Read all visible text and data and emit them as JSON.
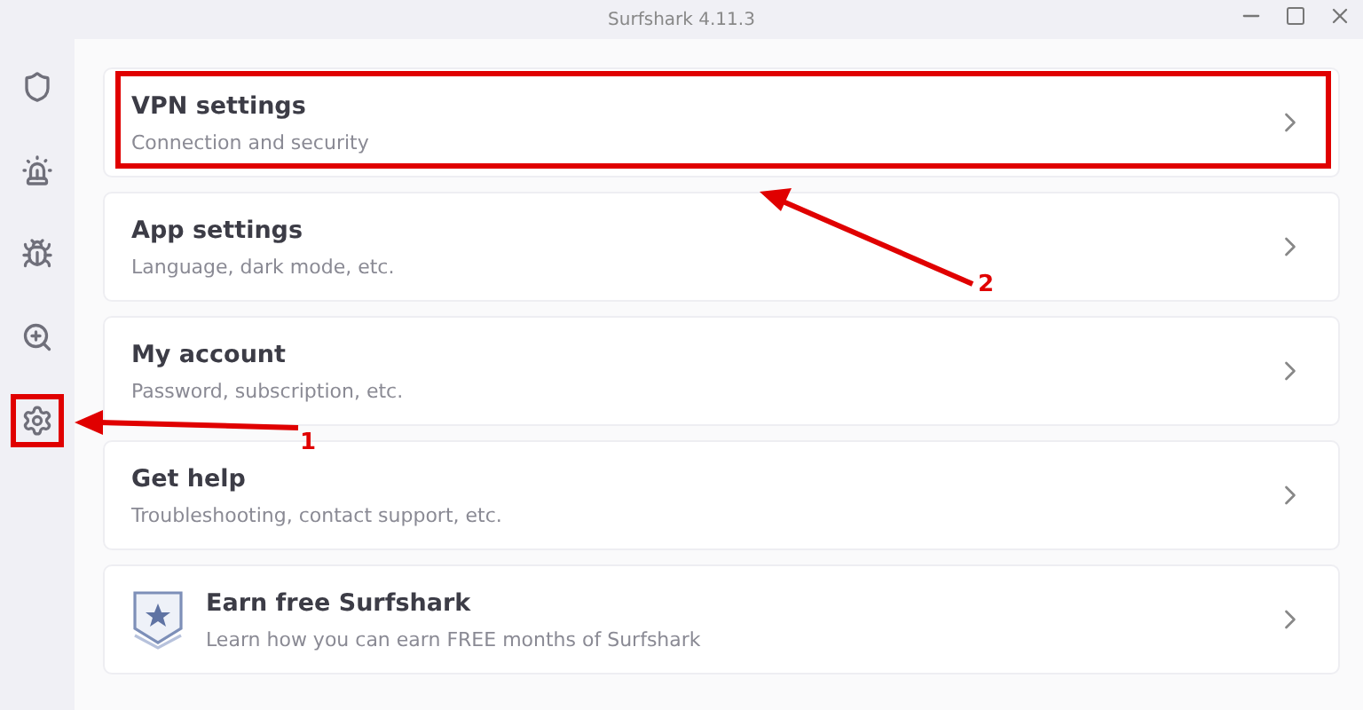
{
  "window": {
    "title": "Surfshark 4.11.3"
  },
  "sidebar": {
    "items": [
      {
        "kind": "shield",
        "highlighted": false
      },
      {
        "kind": "alert",
        "highlighted": false
      },
      {
        "kind": "bug",
        "highlighted": false
      },
      {
        "kind": "search",
        "highlighted": false
      },
      {
        "kind": "settings",
        "highlighted": true,
        "callout": "1"
      }
    ]
  },
  "cards": [
    {
      "kind": "plain",
      "title": "VPN settings",
      "subtitle": "Connection and security",
      "highlighted": true,
      "callout": "2"
    },
    {
      "kind": "plain",
      "title": "App settings",
      "subtitle": "Language, dark mode, etc.",
      "highlighted": false
    },
    {
      "kind": "plain",
      "title": "My account",
      "subtitle": "Password, subscription, etc.",
      "highlighted": false
    },
    {
      "kind": "plain",
      "title": "Get help",
      "subtitle": "Troubleshooting, contact support, etc.",
      "highlighted": false
    },
    {
      "kind": "badge",
      "title": "Earn free Surfshark",
      "subtitle": "Learn how you can earn FREE months of Surfshark",
      "highlighted": false
    }
  ]
}
